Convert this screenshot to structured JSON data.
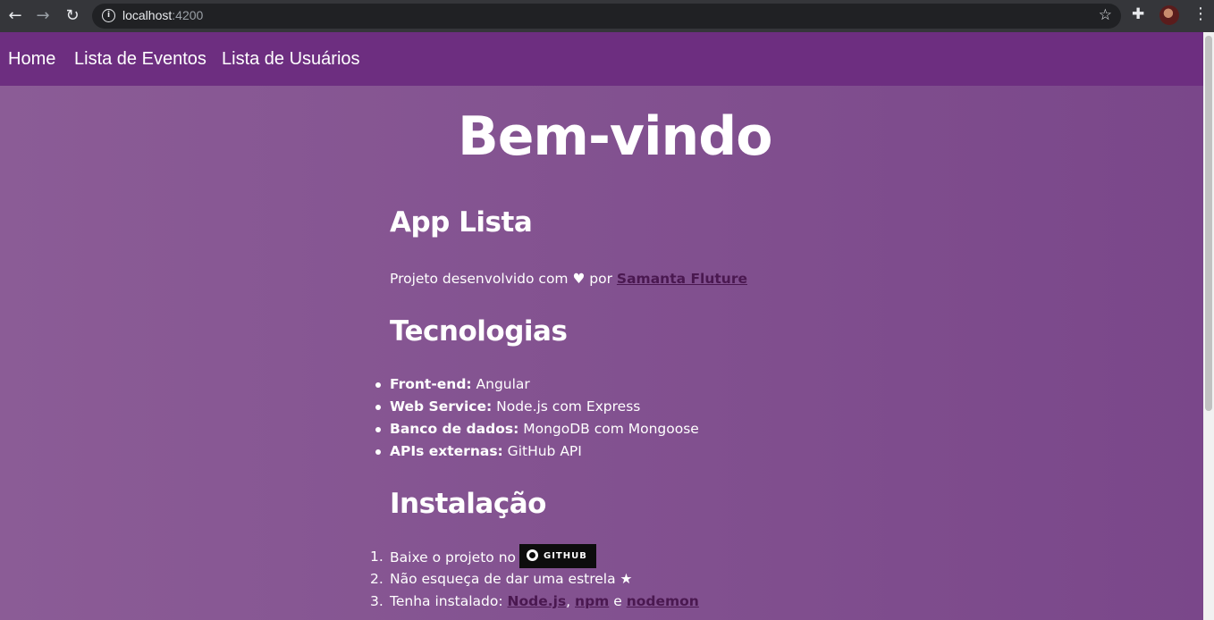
{
  "browser": {
    "url_host": "localhost",
    "url_port": ":4200",
    "icons": [
      "back-icon",
      "forward-icon",
      "reload-icon",
      "info-icon",
      "star-icon",
      "puzzle-icon",
      "avatar",
      "more-icon"
    ]
  },
  "navbar": {
    "items": [
      "Home",
      "Lista de Eventos",
      "Lista de Usuários"
    ]
  },
  "main": {
    "title": "Bem-vindo",
    "app_heading": "App Lista",
    "intro_prefix": "Projeto desenvolvido com ",
    "intro_heart": "♥",
    "intro_mid": " por ",
    "author": "Samanta Fluture",
    "tech_heading": "Tecnologias",
    "tech": [
      {
        "label": "Front-end:",
        "value": " Angular"
      },
      {
        "label": "Web Service:",
        "value": " Node.js com Express"
      },
      {
        "label": "Banco de dados:",
        "value": " MongoDB com Mongoose"
      },
      {
        "label": "APIs externas:",
        "value": " GitHub API"
      }
    ],
    "install_heading": "Instalação",
    "install": {
      "step1_text": "Baixe o projeto no",
      "step1_badge": "GITHUB",
      "step2_text": "Não esqueça de dar uma estrela ★",
      "step3_prefix": "Tenha instalado: ",
      "step3_node": "Node.js",
      "step3_comma": ", ",
      "step3_npm": "npm",
      "step3_and": " e ",
      "step3_nodemon": "nodemon"
    }
  },
  "colors": {
    "navbar": "#6d2e80",
    "background_start": "#8b5c96",
    "background_end": "#7a478a",
    "link": "#4a1850"
  }
}
